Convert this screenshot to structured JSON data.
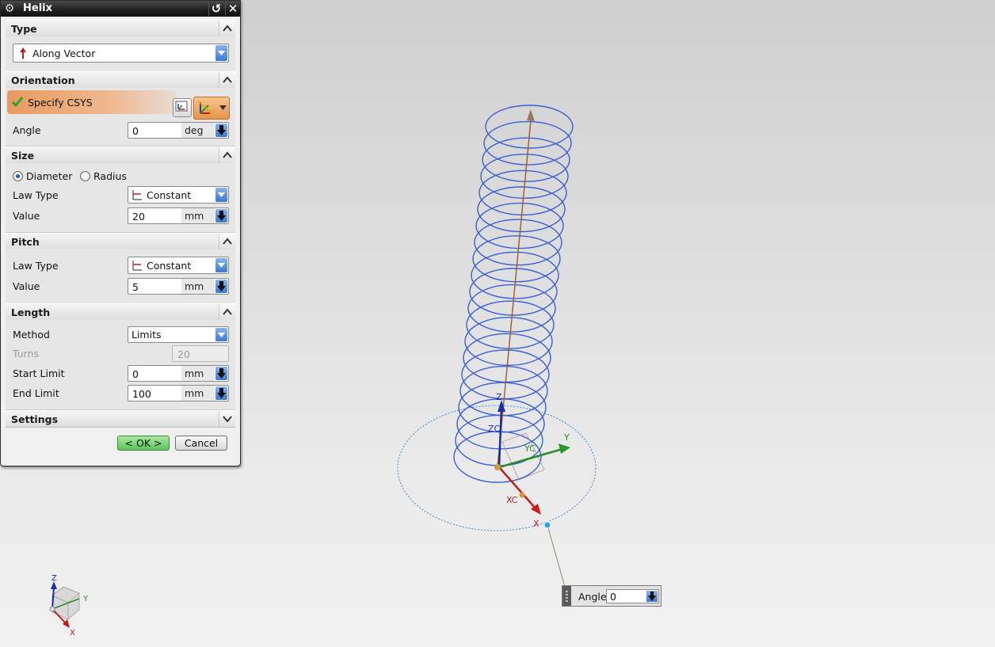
{
  "dialog": {
    "title": "Helix",
    "reset_icon": "reset-icon",
    "close_icon": "close-icon",
    "sections": {
      "type": {
        "header": "Type",
        "type_value": "Along Vector"
      },
      "orientation": {
        "header": "Orientation",
        "csys_label": "Specify CSYS",
        "angle_label": "Angle",
        "angle_value": "0",
        "angle_unit": "deg"
      },
      "size": {
        "header": "Size",
        "radio_diameter": "Diameter",
        "radio_radius": "Radius",
        "selected": "Diameter",
        "law_type_label": "Law Type",
        "law_type_value": "Constant",
        "value_label": "Value",
        "value": "20",
        "unit": "mm"
      },
      "pitch": {
        "header": "Pitch",
        "law_type_label": "Law Type",
        "law_type_value": "Constant",
        "value_label": "Value",
        "value": "5",
        "unit": "mm"
      },
      "length": {
        "header": "Length",
        "method_label": "Method",
        "method_value": "Limits",
        "turns_label": "Turns",
        "turns_value": "20",
        "start_label": "Start Limit",
        "start_value": "0",
        "start_unit": "mm",
        "end_label": "End Limit",
        "end_value": "100",
        "end_unit": "mm"
      },
      "settings": {
        "header": "Settings"
      }
    },
    "ok_label": "< OK >",
    "cancel_label": "Cancel"
  },
  "viewport": {
    "axis_labels": {
      "z": "Z",
      "zc": "ZC",
      "y": "Y",
      "yc": "YC",
      "x": "X",
      "xc": "XC"
    },
    "angle_widget": {
      "label": "Angle",
      "value": "0"
    },
    "triad_labels": {
      "z": "Z",
      "y": "Y",
      "x": "X"
    }
  },
  "colors": {
    "helix": "#3a5fd4",
    "axis_arrow": "#8a5a2a",
    "ok_button": "#7ad07a",
    "csys_highlight": "#e89a5f"
  }
}
